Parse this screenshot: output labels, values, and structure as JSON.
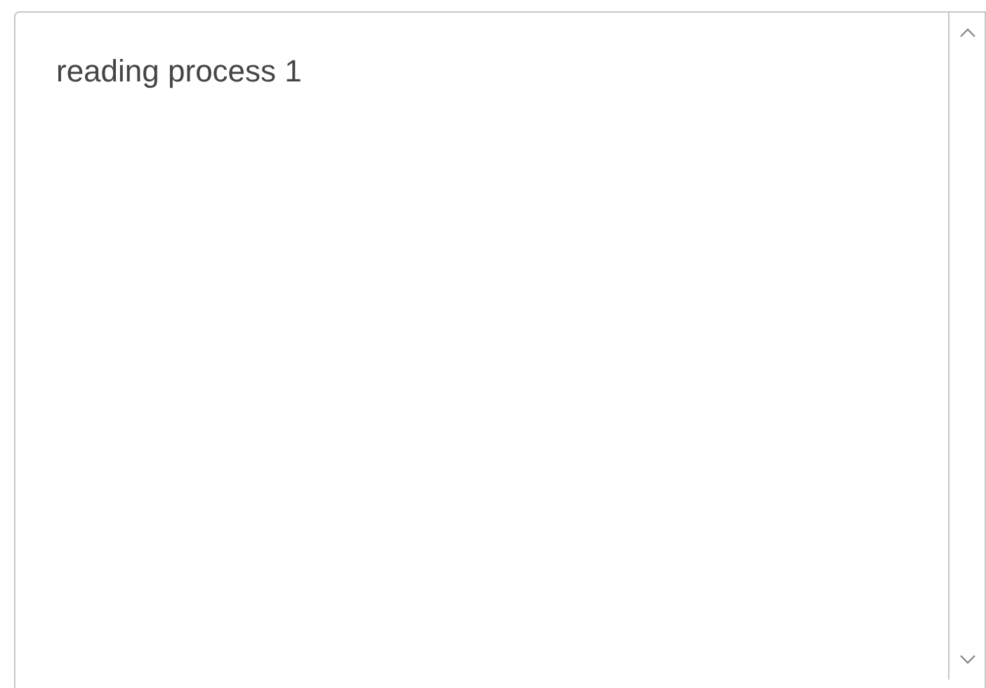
{
  "text_area": {
    "value": "reading process 1"
  }
}
